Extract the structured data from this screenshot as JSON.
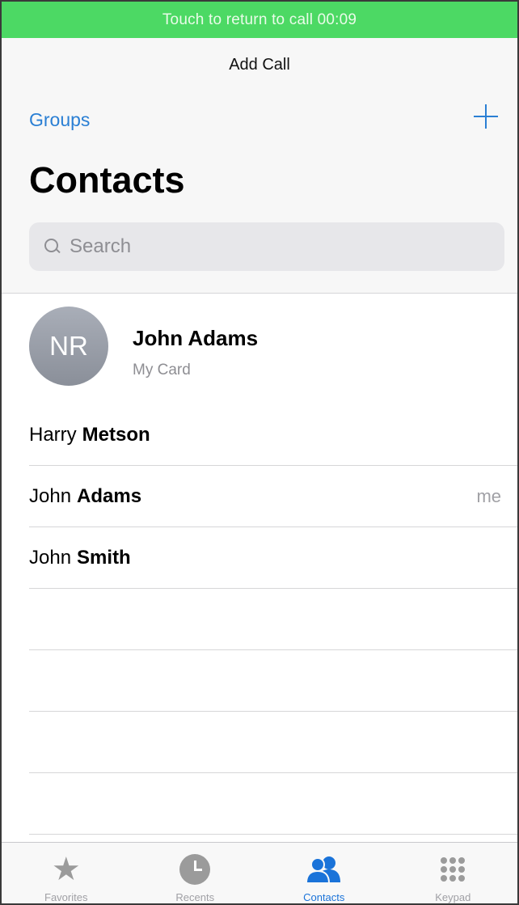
{
  "call_banner": {
    "text": "Touch to return to call 00:09"
  },
  "nav": {
    "add_call": "Add Call",
    "groups": "Groups",
    "title": "Contacts",
    "search_placeholder": "Search"
  },
  "my_card": {
    "initials": "NR",
    "name": "John Adams",
    "subtitle": "My Card"
  },
  "contacts": [
    {
      "first": "Harry",
      "last": "Metson",
      "tag": ""
    },
    {
      "first": "John",
      "last": "Adams",
      "tag": "me"
    },
    {
      "first": "John",
      "last": "Smith",
      "tag": ""
    }
  ],
  "tabs": [
    {
      "label": "Favorites",
      "icon": "star-icon"
    },
    {
      "label": "Recents",
      "icon": "clock-icon"
    },
    {
      "label": "Contacts",
      "icon": "contacts-icon",
      "active": true
    },
    {
      "label": "Keypad",
      "icon": "keypad-icon"
    }
  ],
  "colors": {
    "call_banner": "#4cd964",
    "accent": "#2a7fd4",
    "tab_active": "#1a73d9",
    "tab_inactive": "#9b9b9b"
  }
}
